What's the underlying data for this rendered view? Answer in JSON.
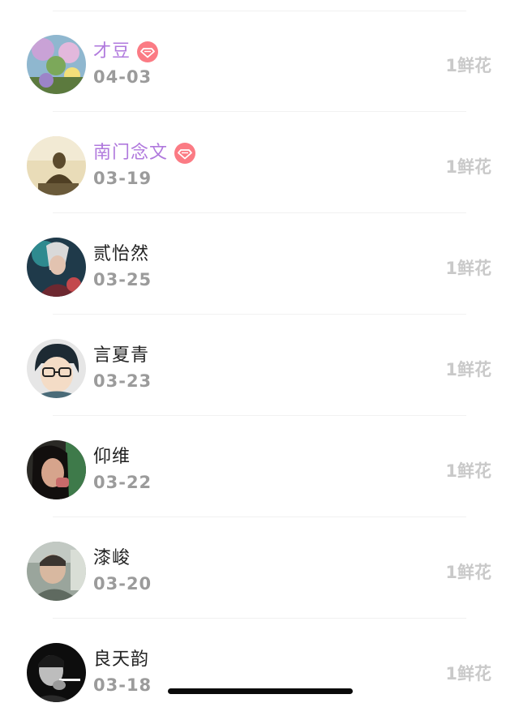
{
  "gift_list": {
    "items": [
      {
        "name": "才豆",
        "date": "04-03",
        "gift": "1鲜花",
        "vip": true,
        "avatar": "avatar-flower-photo"
      },
      {
        "name": "南门念文",
        "date": "03-19",
        "gift": "1鲜花",
        "vip": true,
        "avatar": "avatar-buddha-statue"
      },
      {
        "name": "贰怡然",
        "date": "03-25",
        "gift": "1鲜花",
        "vip": false,
        "avatar": "avatar-game-character"
      },
      {
        "name": "言夏青",
        "date": "03-23",
        "gift": "1鲜花",
        "vip": false,
        "avatar": "avatar-cartoon-glasses"
      },
      {
        "name": "仰维",
        "date": "03-22",
        "gift": "1鲜花",
        "vip": false,
        "avatar": "avatar-woman-portrait"
      },
      {
        "name": "漆峻",
        "date": "03-20",
        "gift": "1鲜花",
        "vip": false,
        "avatar": "avatar-man-photo"
      },
      {
        "name": "良天韵",
        "date": "03-18",
        "gift": "1鲜花",
        "vip": false,
        "avatar": "avatar-bw-smoking"
      }
    ]
  },
  "colors": {
    "vip_name": "#b079dd",
    "vip_badge": "#fb7b84",
    "normal_name": "#222222",
    "date": "#9b9b9b",
    "gift": "#c9c9c9"
  },
  "icons": {
    "vip_badge": "diamond-icon"
  }
}
